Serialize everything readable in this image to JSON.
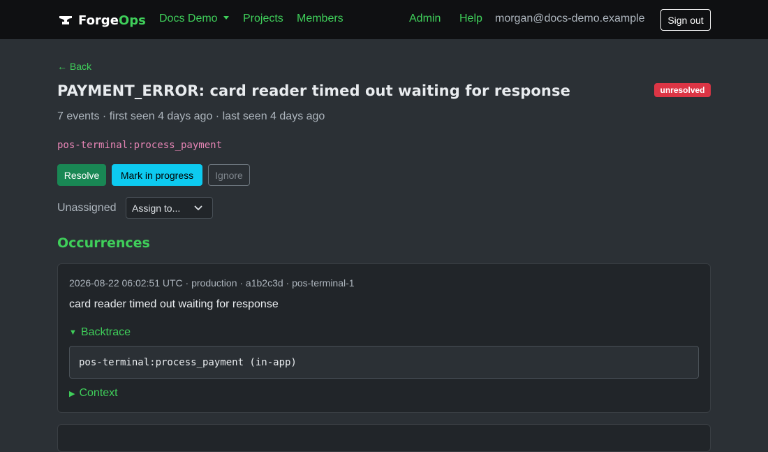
{
  "navbar": {
    "brand_forge": "Forge",
    "brand_ops": "Ops",
    "org_dropdown": "Docs Demo",
    "links": {
      "projects": "Projects",
      "members": "Members",
      "admin": "Admin",
      "help": "Help"
    },
    "user_email": "morgan@docs-demo.example",
    "signout_label": "Sign out"
  },
  "issue": {
    "back_label": "← Back",
    "title": "PAYMENT_ERROR: card reader timed out waiting for response",
    "status": "unresolved",
    "meta": "7 events · first seen 4 days ago · last seen 4 days ago",
    "culprit": "pos-terminal:process_payment",
    "actions": {
      "resolve": "Resolve",
      "in_progress": "Mark in progress",
      "ignore": "Ignore"
    },
    "assignee_label": "Unassigned",
    "assign_select": "Assign to..."
  },
  "occurrences": {
    "title": "Occurrences",
    "items": [
      {
        "meta": "2026-08-22 06:02:51 UTC · production · a1b2c3d · pos-terminal-1",
        "message": "card reader timed out waiting for response",
        "backtrace_label": "Backtrace",
        "backtrace_line": "pos-terminal:process_payment (in-app)",
        "context_label": "Context"
      }
    ]
  },
  "colors": {
    "accent": "#3fcf5a",
    "danger": "#dc3545",
    "success": "#198754",
    "info": "#0dcaf0",
    "background": "#2b3035",
    "navbar": "#0f1012"
  },
  "icons": {
    "brand": "anvil-icon",
    "org_caret": "caret-down-icon",
    "assign_chevron": "chevron-down-icon",
    "backtrace_toggle": "triangle-down-icon",
    "context_toggle": "triangle-right-icon"
  }
}
